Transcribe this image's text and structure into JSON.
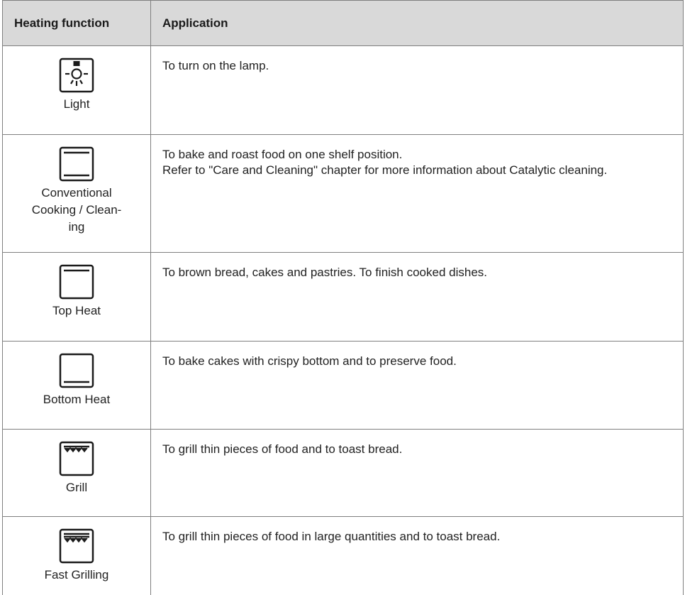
{
  "table": {
    "header": {
      "function": "Heating function",
      "application": "Application"
    },
    "rows": [
      {
        "icon": "light-icon",
        "function": "Light",
        "application": [
          "To turn on the lamp."
        ]
      },
      {
        "icon": "conventional-cooking-icon",
        "function": "Conventional Cooking / Clean-ing",
        "application": [
          "To bake and roast food on one shelf position.",
          "Refer to \"Care and Cleaning\" chapter for more information about Catalytic cleaning."
        ]
      },
      {
        "icon": "top-heat-icon",
        "function": "Top Heat",
        "application": [
          "To brown bread, cakes and pastries. To finish cooked dishes."
        ]
      },
      {
        "icon": "bottom-heat-icon",
        "function": "Bottom Heat",
        "application": [
          "To bake cakes with crispy bottom and to preserve food."
        ]
      },
      {
        "icon": "grill-icon",
        "function": "Grill",
        "application": [
          "To grill thin pieces of food and to toast bread."
        ]
      },
      {
        "icon": "fast-grilling-icon",
        "function": "Fast Grilling",
        "application": [
          "To grill thin pieces of food in large quantities and to toast bread."
        ]
      }
    ]
  }
}
